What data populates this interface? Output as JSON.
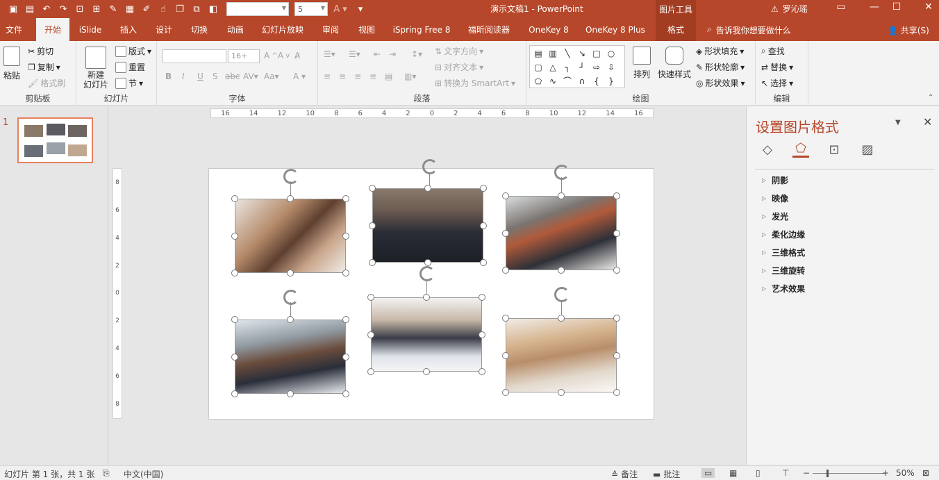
{
  "window": {
    "title": "演示文稿1 - PowerPoint",
    "context_tools": "图片工具",
    "user": "罗沁瑶",
    "font_size_qat": "5"
  },
  "tabs": [
    {
      "label": "文件"
    },
    {
      "label": "开始"
    },
    {
      "label": "iSlide"
    },
    {
      "label": "插入"
    },
    {
      "label": "设计"
    },
    {
      "label": "切换"
    },
    {
      "label": "动画"
    },
    {
      "label": "幻灯片放映"
    },
    {
      "label": "审阅"
    },
    {
      "label": "视图"
    },
    {
      "label": "iSpring Free 8"
    },
    {
      "label": "福昕阅读器"
    },
    {
      "label": "OneKey 8"
    },
    {
      "label": "OneKey 8 Plus"
    },
    {
      "label": "格式"
    }
  ],
  "tell_me": "告诉我你想要做什么",
  "share": "共享(S)",
  "ribbon": {
    "clipboard": {
      "label": "剪贴板",
      "paste": "粘贴",
      "cut": "剪切",
      "copy": "复制",
      "format_painter": "格式刷"
    },
    "slides": {
      "label": "幻灯片",
      "new_slide_1": "新建",
      "new_slide_2": "幻灯片",
      "layout": "版式",
      "reset": "重置",
      "section": "节"
    },
    "font": {
      "label": "字体",
      "size": "16+"
    },
    "paragraph": {
      "label": "段落",
      "text_direction": "文字方向",
      "align_text": "对齐文本",
      "convert_smartart": "转换为 SmartArt"
    },
    "drawing": {
      "label": "绘图",
      "arrange": "排列",
      "quick_styles": "快速样式",
      "shape_fill": "形状填充",
      "shape_outline": "形状轮廓",
      "shape_effects": "形状效果"
    },
    "editing": {
      "label": "编辑",
      "find": "查找",
      "replace": "替换",
      "select": "选择"
    }
  },
  "slide_pane": {
    "slide_number": "1"
  },
  "rulers": {
    "horizontal": [
      "16",
      "14",
      "12",
      "10",
      "8",
      "6",
      "4",
      "2",
      "0",
      "2",
      "4",
      "6",
      "8",
      "10",
      "12",
      "14",
      "16"
    ],
    "vertical": [
      "8",
      "6",
      "4",
      "2",
      "0",
      "2",
      "4",
      "6",
      "8"
    ]
  },
  "task_pane": {
    "title": "设置图片格式",
    "items": [
      "阴影",
      "映像",
      "发光",
      "柔化边缘",
      "三维格式",
      "三维旋转",
      "艺术效果"
    ]
  },
  "status": {
    "slide_info": "幻灯片 第 1 张，共 1 张",
    "language": "中文(中国)",
    "notes": "备注",
    "comments": "批注",
    "zoom": "50%"
  },
  "colors": {
    "accent": "#b7472a",
    "ribbon_bg": "#f3f3f3",
    "canvas_bg": "#e6e6e6"
  },
  "icons": [
    "save-icon",
    "open-icon",
    "undo-icon",
    "redo-icon",
    "search-icon",
    "close-icon",
    "rotate-handle-icon",
    "fill-icon",
    "effects-icon",
    "size-icon",
    "picture-icon"
  ]
}
